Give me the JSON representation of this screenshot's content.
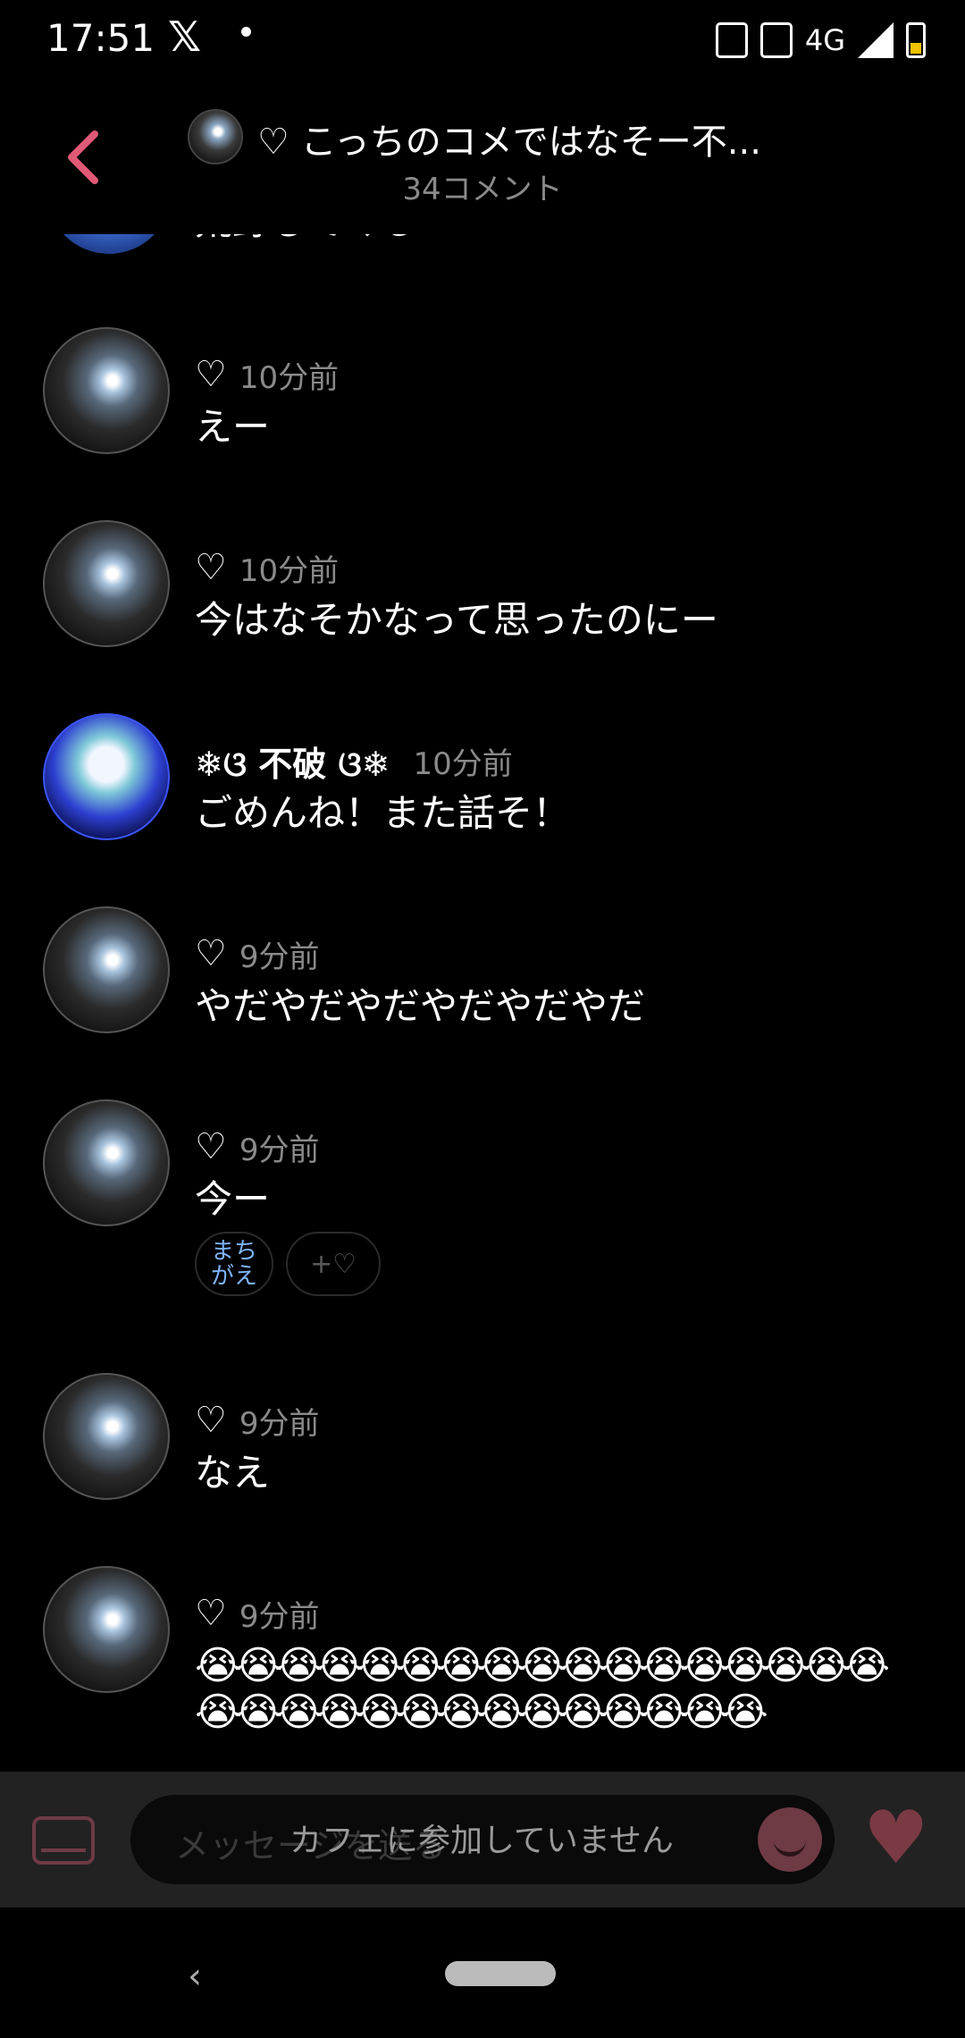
{
  "status": {
    "time": "17:51",
    "network": "4G"
  },
  "header": {
    "title": "♡ こっちのコメではなそー不...",
    "subtitle": "34コメント"
  },
  "partial_comment": {
    "text": "荒野してくる"
  },
  "comments": [
    {
      "author": "",
      "time": "10分前",
      "text": "えー"
    },
    {
      "author": "",
      "time": "10分前",
      "text": "今はなそかなって思ったのにー"
    },
    {
      "author": "❄︎ଓ 不破 ଓ❄︎",
      "time": "10分前",
      "text": "ごめんね！また話そ！"
    },
    {
      "author": "",
      "time": "9分前",
      "text": "やだやだやだやだやだやだ"
    },
    {
      "author": "",
      "time": "9分前",
      "text": "今ー",
      "reaction_label": "まちがえ",
      "add_reaction": "+♡"
    },
    {
      "author": "",
      "time": "9分前",
      "text": "なえ"
    },
    {
      "author": "",
      "time": "9分前",
      "text": "😭😭😭😭😭😭😭😭😭😭😭😭😭😭😭😭😭😭😭😭😭😭😭😭😭😭😭😭😭😭😭"
    }
  ],
  "input": {
    "placeholder": "メッセージを送る",
    "overlay": "カフェに参加していません"
  },
  "icons": {
    "heart": "heart-icon",
    "back": "chevron-left-icon"
  },
  "colors": {
    "accent": "#e05a76",
    "muted": "#8a8a8a"
  }
}
